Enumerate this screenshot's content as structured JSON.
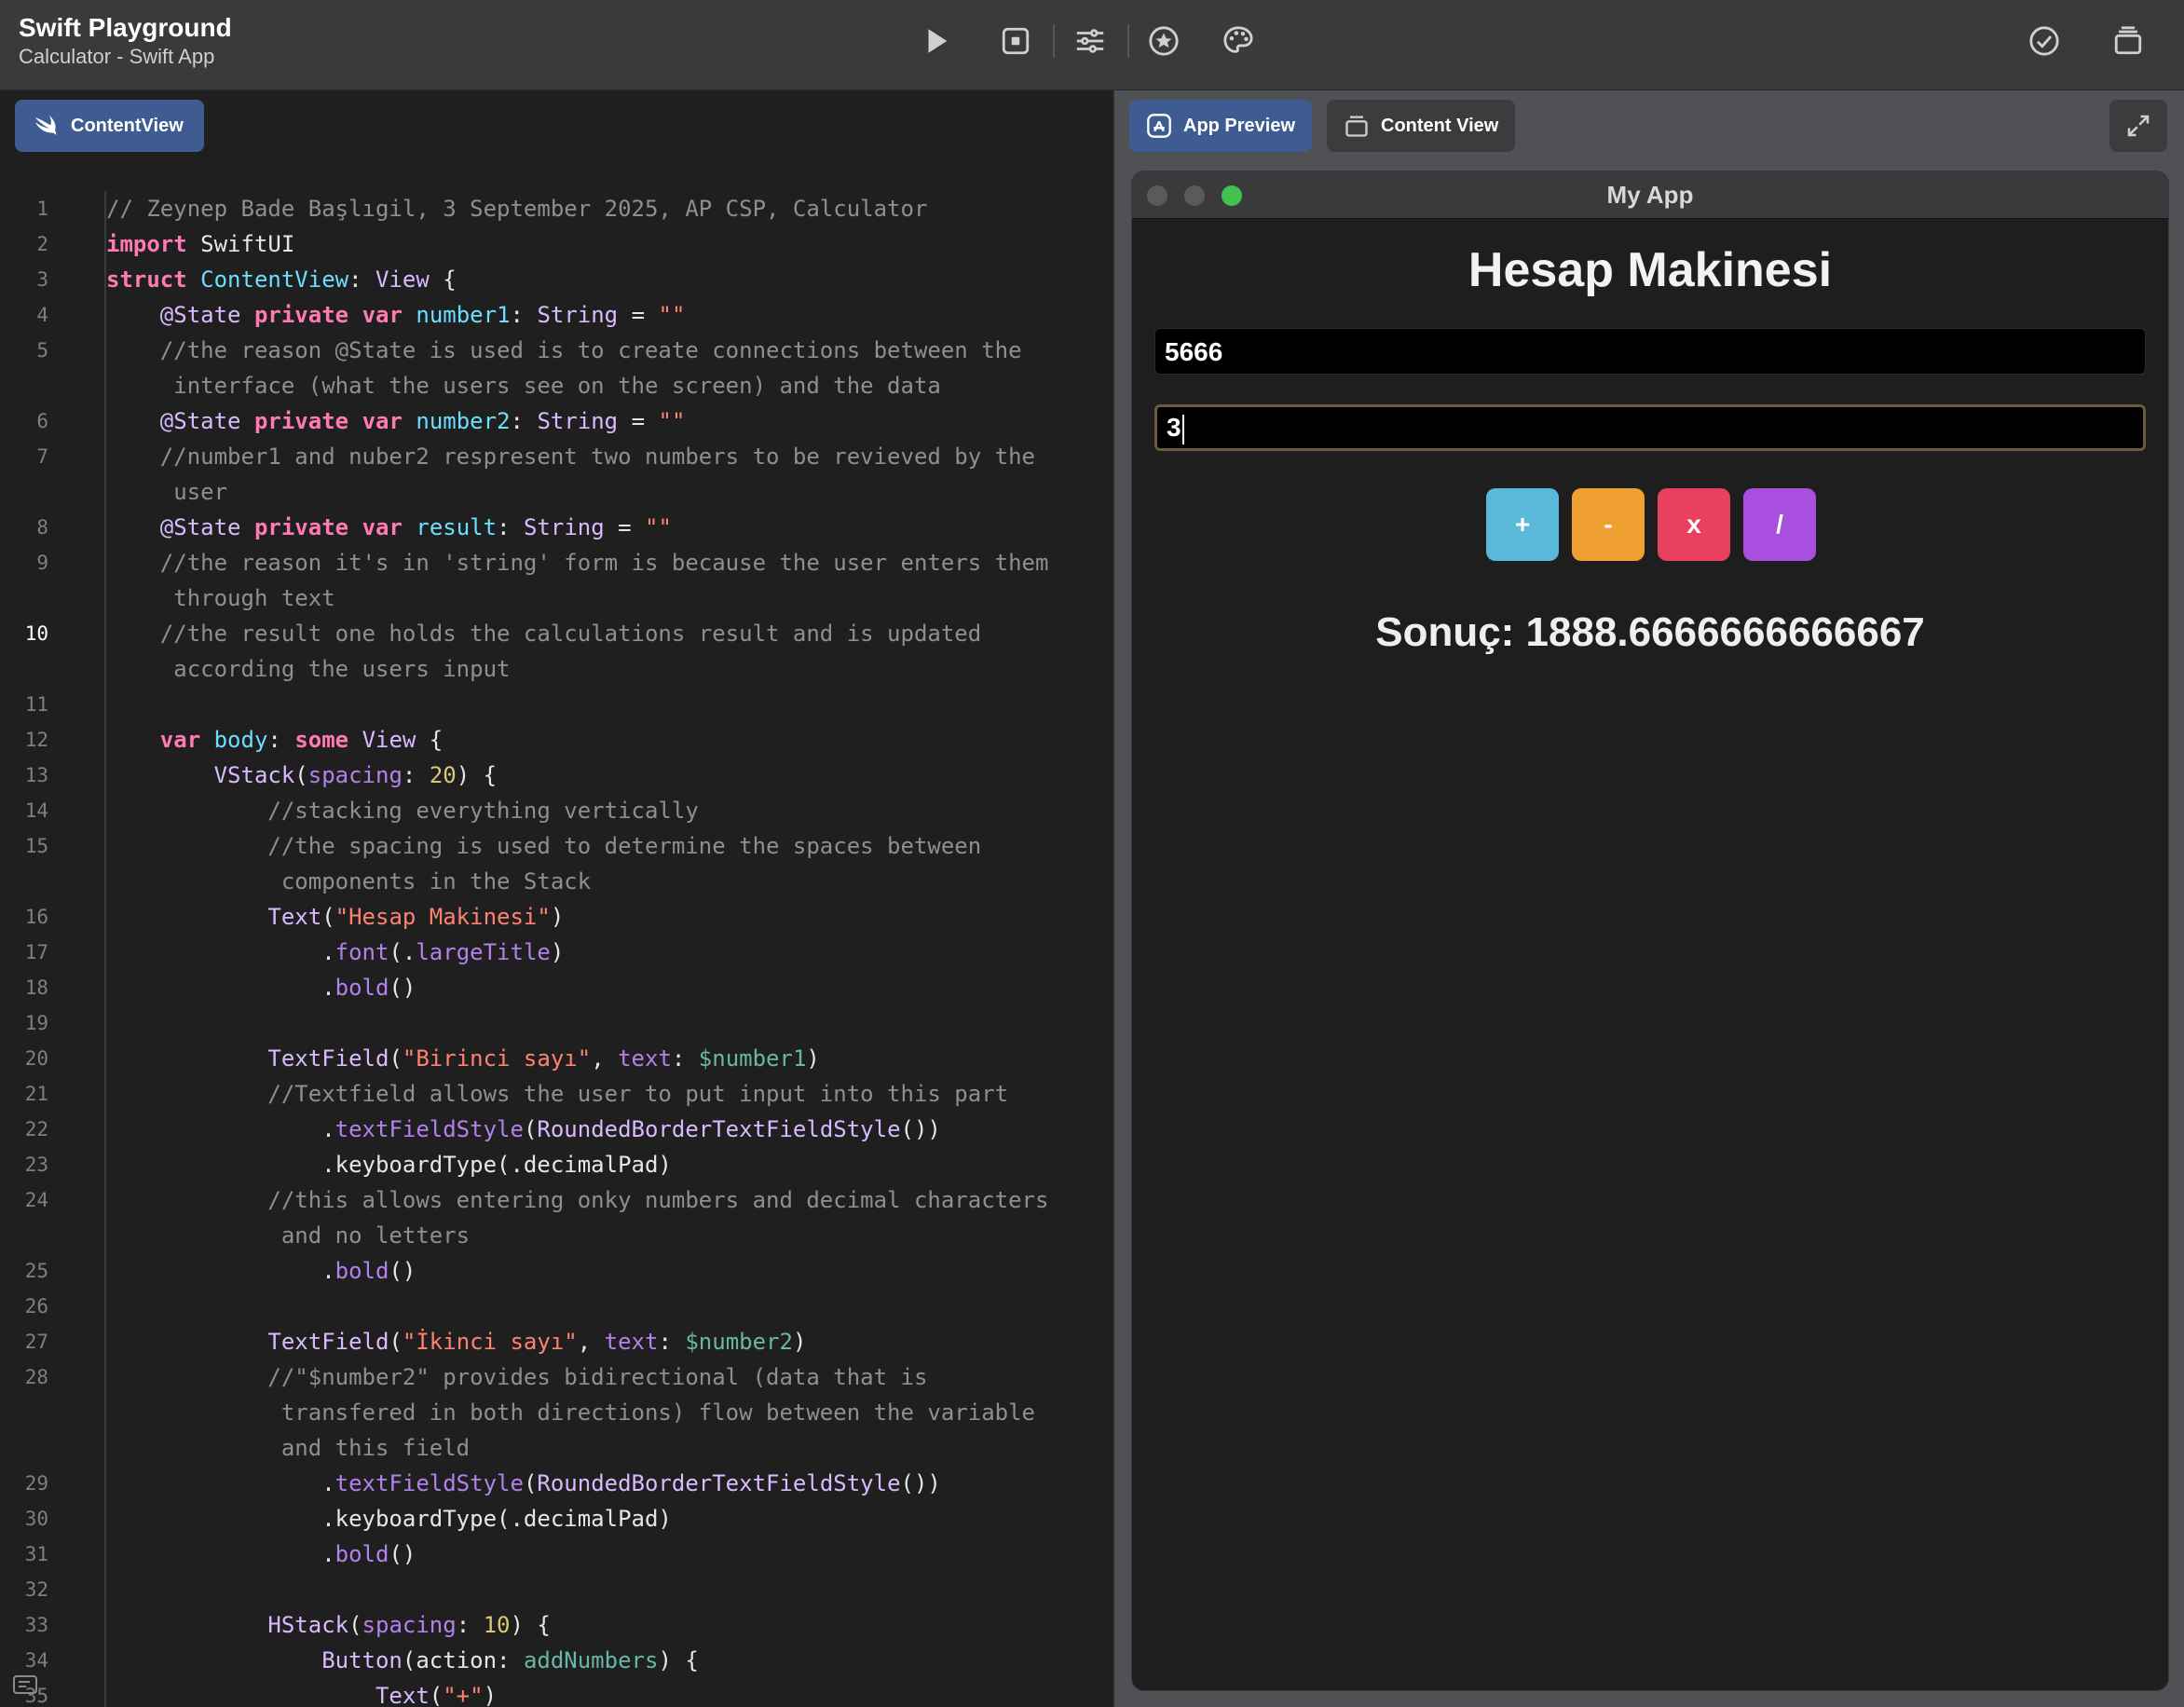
{
  "topbar": {
    "title": "Swift Playground",
    "subtitle": "Calculator - Swift App",
    "icons": [
      "play-icon",
      "stop-icon",
      "sliders-icon",
      "star-icon",
      "palette-icon",
      "checkmark-icon",
      "stack-icon"
    ]
  },
  "editor": {
    "file_tab": "ContentView",
    "current_line": 10,
    "lines": [
      {
        "n": "1",
        "t": [
          {
            "c": "com",
            "s": "// Zeynep Bade Başlıgil, 3 September 2025, AP CSP, Calculator"
          }
        ]
      },
      {
        "n": "2",
        "t": [
          {
            "c": "kw",
            "s": "import"
          },
          {
            "c": "",
            "s": " SwiftUI"
          }
        ]
      },
      {
        "n": "3",
        "t": [
          {
            "c": "kw",
            "s": "struct"
          },
          {
            "c": "",
            "s": " "
          },
          {
            "c": "prop",
            "s": "ContentView"
          },
          {
            "c": "",
            "s": ": "
          },
          {
            "c": "type",
            "s": "View"
          },
          {
            "c": "",
            "s": " {"
          }
        ]
      },
      {
        "n": "4",
        "t": [
          {
            "c": "",
            "s": "    "
          },
          {
            "c": "type",
            "s": "@State"
          },
          {
            "c": "",
            "s": " "
          },
          {
            "c": "kw",
            "s": "private"
          },
          {
            "c": "",
            "s": " "
          },
          {
            "c": "kw",
            "s": "var"
          },
          {
            "c": "",
            "s": " "
          },
          {
            "c": "prop",
            "s": "number1"
          },
          {
            "c": "",
            "s": ": "
          },
          {
            "c": "type",
            "s": "String"
          },
          {
            "c": "",
            "s": " = "
          },
          {
            "c": "str",
            "s": "\"\""
          }
        ]
      },
      {
        "n": "5",
        "t": [
          {
            "c": "com",
            "s": "    //the reason @State is used is to create connections between the"
          }
        ]
      },
      {
        "n": "",
        "t": [
          {
            "c": "com",
            "s": "     interface (what the users see on the screen) and the data"
          }
        ]
      },
      {
        "n": "6",
        "t": [
          {
            "c": "",
            "s": "    "
          },
          {
            "c": "type",
            "s": "@State"
          },
          {
            "c": "",
            "s": " "
          },
          {
            "c": "kw",
            "s": "private"
          },
          {
            "c": "",
            "s": " "
          },
          {
            "c": "kw",
            "s": "var"
          },
          {
            "c": "",
            "s": " "
          },
          {
            "c": "prop",
            "s": "number2"
          },
          {
            "c": "",
            "s": ": "
          },
          {
            "c": "type",
            "s": "String"
          },
          {
            "c": "",
            "s": " = "
          },
          {
            "c": "str",
            "s": "\"\""
          }
        ]
      },
      {
        "n": "7",
        "t": [
          {
            "c": "com",
            "s": "    //number1 and nuber2 respresent two numbers to be revieved by the"
          }
        ]
      },
      {
        "n": "",
        "t": [
          {
            "c": "com",
            "s": "     user"
          }
        ]
      },
      {
        "n": "8",
        "t": [
          {
            "c": "",
            "s": "    "
          },
          {
            "c": "type",
            "s": "@State"
          },
          {
            "c": "",
            "s": " "
          },
          {
            "c": "kw",
            "s": "private"
          },
          {
            "c": "",
            "s": " "
          },
          {
            "c": "kw",
            "s": "var"
          },
          {
            "c": "",
            "s": " "
          },
          {
            "c": "prop",
            "s": "result"
          },
          {
            "c": "",
            "s": ": "
          },
          {
            "c": "type",
            "s": "String"
          },
          {
            "c": "",
            "s": " = "
          },
          {
            "c": "str",
            "s": "\"\""
          }
        ]
      },
      {
        "n": "9",
        "t": [
          {
            "c": "com",
            "s": "    //the reason it's in 'string' form is because the user enters them"
          }
        ]
      },
      {
        "n": "",
        "t": [
          {
            "c": "com",
            "s": "     through text"
          }
        ]
      },
      {
        "n": "10",
        "t": [
          {
            "c": "com",
            "s": "    //the result one holds the calculations result and is updated"
          }
        ]
      },
      {
        "n": "",
        "t": [
          {
            "c": "com",
            "s": "     according the users input"
          }
        ]
      },
      {
        "n": "11",
        "t": [
          {
            "c": "",
            "s": ""
          }
        ]
      },
      {
        "n": "12",
        "t": [
          {
            "c": "",
            "s": "    "
          },
          {
            "c": "kw",
            "s": "var"
          },
          {
            "c": "",
            "s": " "
          },
          {
            "c": "prop",
            "s": "body"
          },
          {
            "c": "",
            "s": ": "
          },
          {
            "c": "kw",
            "s": "some"
          },
          {
            "c": "",
            "s": " "
          },
          {
            "c": "type",
            "s": "View"
          },
          {
            "c": "",
            "s": " {"
          }
        ]
      },
      {
        "n": "13",
        "t": [
          {
            "c": "",
            "s": "        "
          },
          {
            "c": "type",
            "s": "VStack"
          },
          {
            "c": "",
            "s": "("
          },
          {
            "c": "fn",
            "s": "spacing"
          },
          {
            "c": "",
            "s": ": "
          },
          {
            "c": "num",
            "s": "20"
          },
          {
            "c": "",
            "s": ") {"
          }
        ]
      },
      {
        "n": "14",
        "t": [
          {
            "c": "com",
            "s": "            //stacking everything vertically"
          }
        ]
      },
      {
        "n": "15",
        "t": [
          {
            "c": "com",
            "s": "            //the spacing is used to determine the spaces between"
          }
        ]
      },
      {
        "n": "",
        "t": [
          {
            "c": "com",
            "s": "             components in the Stack"
          }
        ]
      },
      {
        "n": "16",
        "t": [
          {
            "c": "",
            "s": "            "
          },
          {
            "c": "type",
            "s": "Text"
          },
          {
            "c": "",
            "s": "("
          },
          {
            "c": "str",
            "s": "\"Hesap Makinesi\""
          },
          {
            "c": "",
            "s": ")"
          }
        ]
      },
      {
        "n": "17",
        "t": [
          {
            "c": "",
            "s": "                ."
          },
          {
            "c": "fn",
            "s": "font"
          },
          {
            "c": "",
            "s": "(."
          },
          {
            "c": "fn",
            "s": "largeTitle"
          },
          {
            "c": "",
            "s": ")"
          }
        ]
      },
      {
        "n": "18",
        "t": [
          {
            "c": "",
            "s": "                ."
          },
          {
            "c": "fn",
            "s": "bold"
          },
          {
            "c": "",
            "s": "()"
          }
        ]
      },
      {
        "n": "19",
        "t": [
          {
            "c": "",
            "s": ""
          }
        ]
      },
      {
        "n": "20",
        "t": [
          {
            "c": "",
            "s": "            "
          },
          {
            "c": "type",
            "s": "TextField"
          },
          {
            "c": "",
            "s": "("
          },
          {
            "c": "str",
            "s": "\"Birinci sayı\""
          },
          {
            "c": "",
            "s": ", "
          },
          {
            "c": "fn",
            "s": "text"
          },
          {
            "c": "",
            "s": ": "
          },
          {
            "c": "bind",
            "s": "$number1"
          },
          {
            "c": "",
            "s": ")"
          }
        ]
      },
      {
        "n": "21",
        "t": [
          {
            "c": "com",
            "s": "            //Textfield allows the user to put input into this part"
          }
        ]
      },
      {
        "n": "22",
        "t": [
          {
            "c": "",
            "s": "                ."
          },
          {
            "c": "fn",
            "s": "textFieldStyle"
          },
          {
            "c": "",
            "s": "("
          },
          {
            "c": "type",
            "s": "RoundedBorderTextFieldStyle"
          },
          {
            "c": "",
            "s": "())"
          }
        ]
      },
      {
        "n": "23",
        "t": [
          {
            "c": "",
            "s": "                .keyboardType(.decimalPad)"
          }
        ]
      },
      {
        "n": "24",
        "t": [
          {
            "c": "com",
            "s": "            //this allows entering onky numbers and decimal characters"
          }
        ]
      },
      {
        "n": "",
        "t": [
          {
            "c": "com",
            "s": "             and no letters"
          }
        ]
      },
      {
        "n": "25",
        "t": [
          {
            "c": "",
            "s": "                ."
          },
          {
            "c": "fn",
            "s": "bold"
          },
          {
            "c": "",
            "s": "()"
          }
        ]
      },
      {
        "n": "26",
        "t": [
          {
            "c": "",
            "s": ""
          }
        ]
      },
      {
        "n": "27",
        "t": [
          {
            "c": "",
            "s": "            "
          },
          {
            "c": "type",
            "s": "TextField"
          },
          {
            "c": "",
            "s": "("
          },
          {
            "c": "str",
            "s": "\"İkinci sayı\""
          },
          {
            "c": "",
            "s": ", "
          },
          {
            "c": "fn",
            "s": "text"
          },
          {
            "c": "",
            "s": ": "
          },
          {
            "c": "bind",
            "s": "$number2"
          },
          {
            "c": "",
            "s": ")"
          }
        ]
      },
      {
        "n": "28",
        "t": [
          {
            "c": "com",
            "s": "            //\"$number2\" provides bidirectional (data that is"
          }
        ]
      },
      {
        "n": "",
        "t": [
          {
            "c": "com",
            "s": "             transfered in both directions) flow between the variable"
          }
        ]
      },
      {
        "n": "",
        "t": [
          {
            "c": "com",
            "s": "             and this field"
          }
        ]
      },
      {
        "n": "29",
        "t": [
          {
            "c": "",
            "s": "                ."
          },
          {
            "c": "fn",
            "s": "textFieldStyle"
          },
          {
            "c": "",
            "s": "("
          },
          {
            "c": "type",
            "s": "RoundedBorderTextFieldStyle"
          },
          {
            "c": "",
            "s": "())"
          }
        ]
      },
      {
        "n": "30",
        "t": [
          {
            "c": "",
            "s": "                .keyboardType(.decimalPad)"
          }
        ]
      },
      {
        "n": "31",
        "t": [
          {
            "c": "",
            "s": "                ."
          },
          {
            "c": "fn",
            "s": "bold"
          },
          {
            "c": "",
            "s": "()"
          }
        ]
      },
      {
        "n": "32",
        "t": [
          {
            "c": "",
            "s": ""
          }
        ]
      },
      {
        "n": "33",
        "t": [
          {
            "c": "",
            "s": "            "
          },
          {
            "c": "type",
            "s": "HStack"
          },
          {
            "c": "",
            "s": "("
          },
          {
            "c": "fn",
            "s": "spacing"
          },
          {
            "c": "",
            "s": ": "
          },
          {
            "c": "num",
            "s": "10"
          },
          {
            "c": "",
            "s": ") {"
          }
        ]
      },
      {
        "n": "34",
        "t": [
          {
            "c": "",
            "s": "                "
          },
          {
            "c": "type",
            "s": "Button"
          },
          {
            "c": "",
            "s": "(action: "
          },
          {
            "c": "bind",
            "s": "addNumbers"
          },
          {
            "c": "",
            "s": ") {"
          }
        ]
      },
      {
        "n": "35",
        "t": [
          {
            "c": "",
            "s": "                    "
          },
          {
            "c": "type",
            "s": "Text"
          },
          {
            "c": "",
            "s": "("
          },
          {
            "c": "str",
            "s": "\"+\""
          },
          {
            "c": "",
            "s": ")"
          }
        ]
      }
    ]
  },
  "preview": {
    "tabs": [
      "App Preview",
      "Content View"
    ],
    "window_title": "My App",
    "calc_title": "Hesap Makinesi",
    "number1_value": "5666",
    "number2_value": "3",
    "buttons": [
      {
        "label": "+",
        "color": "#5ab9d8"
      },
      {
        "label": "-",
        "color": "#f0a030"
      },
      {
        "label": "x",
        "color": "#e8405e"
      },
      {
        "label": "/",
        "color": "#a84fe0"
      }
    ],
    "result": "Sonuç: 1888.6666666666667"
  },
  "colors": {
    "accent_tab": "#3e5c91",
    "traffic_close": "#5a5a5c",
    "traffic_min": "#5a5a5c",
    "traffic_zoom": "#3fc24e"
  }
}
